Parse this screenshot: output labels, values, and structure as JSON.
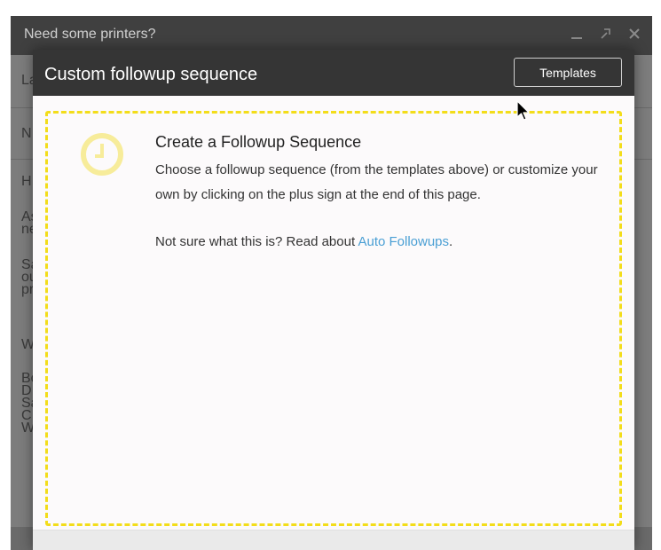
{
  "compose": {
    "title": "Need some printers?",
    "controls": {
      "minimize": "_",
      "popout": "↗",
      "close": "×"
    },
    "behind_fragments": [
      "La",
      "N",
      "H",
      "As\nne",
      "Sa\nou\npr",
      "W",
      "Bo\nD\nSa\nC\nW"
    ]
  },
  "modal": {
    "title": "Custom followup sequence",
    "templates_label": "Templates",
    "content": {
      "heading": "Create a Followup Sequence",
      "description": "Choose a followup sequence (from the templates above) or customize your own by clicking on the plus sign at the end of this page.",
      "help_prefix": "Not sure what this is? Read about ",
      "help_link": "Auto Followups",
      "help_suffix": "."
    }
  },
  "icons": {
    "clock": "clock-icon",
    "cursor": "mouse-pointer-icon"
  },
  "colors": {
    "accent_yellow": "#f3dd1a",
    "link_blue": "#4a9fd4",
    "modal_header": "#353535"
  }
}
